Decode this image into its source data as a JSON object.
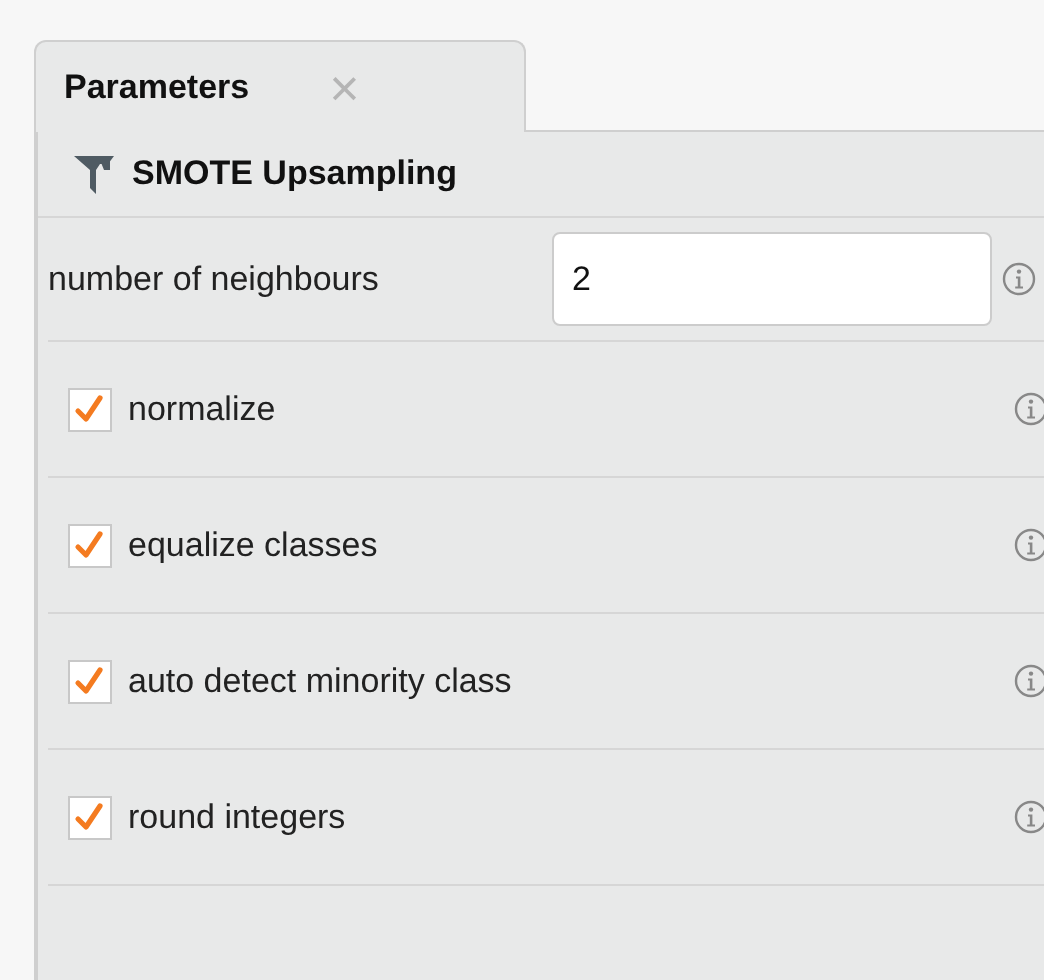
{
  "tabs": [
    {
      "label": "Parameters",
      "close": "×",
      "selected": true
    }
  ],
  "operator": {
    "title": "SMOTE Upsampling"
  },
  "parameters": [
    {
      "kind": "number",
      "label": "number of neighbours",
      "value": "2"
    },
    {
      "kind": "checkbox",
      "label": "normalize",
      "checked": true
    },
    {
      "kind": "checkbox",
      "label": "equalize classes",
      "checked": true
    },
    {
      "kind": "checkbox",
      "label": "auto detect minority class",
      "checked": true
    },
    {
      "kind": "checkbox",
      "label": "round integers",
      "checked": true
    }
  ]
}
